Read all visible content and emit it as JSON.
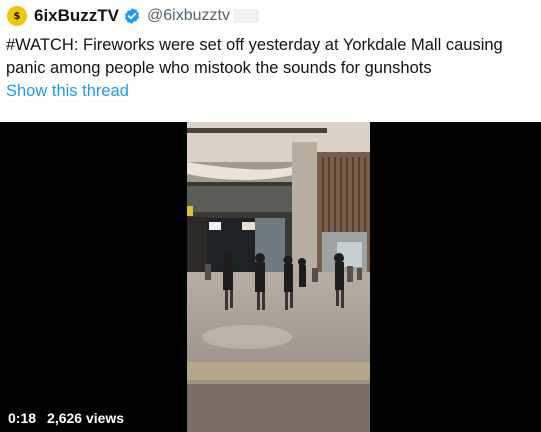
{
  "author": {
    "avatar_glyph": "$",
    "display_name": "6ixBuzzTV",
    "handle": "@6ixbuzztv",
    "verified_color": "#1d9bf0"
  },
  "tweet": {
    "text": "#WATCH: Fireworks were set off yesterday at Yorkdale Mall causing panic among people who mistook the sounds for gunshots",
    "show_thread": "Show this thread"
  },
  "video": {
    "time": "0:18",
    "views": "2,626 views"
  },
  "colors": {
    "link": "#1d9bf0",
    "secondary_text": "#536471",
    "avatar": "#f5c400"
  }
}
